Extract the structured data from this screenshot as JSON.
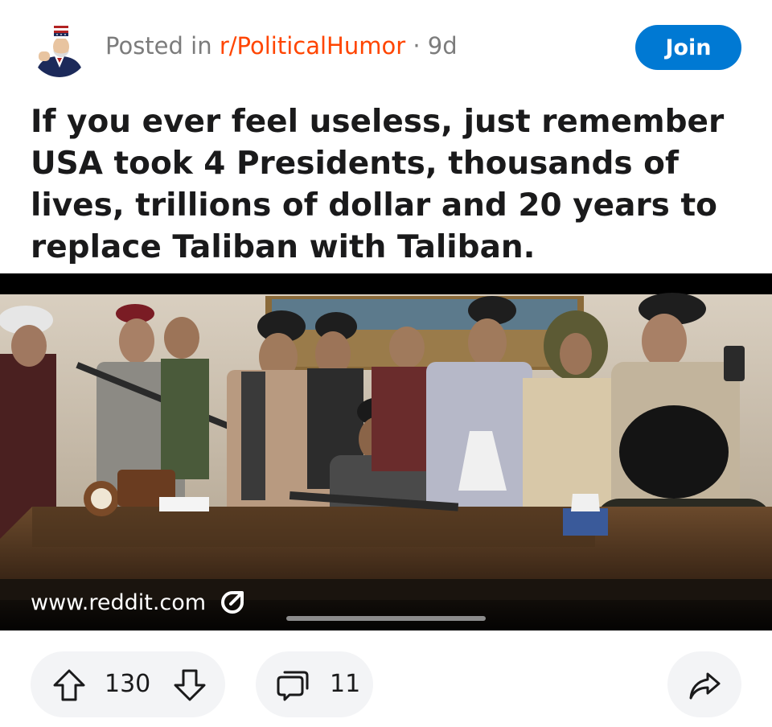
{
  "post": {
    "posted_in_prefix": "Posted in ",
    "subreddit": "r/PoliticalHumor",
    "separator": " · ",
    "age": "9d",
    "join_label": "Join",
    "title": "If you ever feel useless, just remember USA took 4 Presidents, thousands of lives, trillions of dollar and 20 years to replace Taliban with Taliban."
  },
  "media": {
    "link_domain": "www.reddit.com",
    "link_icon": "external-link-icon"
  },
  "actions": {
    "upvotes": "130",
    "comments": "11",
    "upvote_icon": "upvote-arrow-icon",
    "downvote_icon": "downvote-arrow-icon",
    "comment_icon": "comment-bubble-icon",
    "share_icon": "share-arrow-icon"
  },
  "colors": {
    "subreddit": "#ff4500",
    "join_button": "#0079d3",
    "meta_text": "#7c7c7c",
    "title_text": "#1a1a1b",
    "pill_background": "#f3f4f6"
  }
}
